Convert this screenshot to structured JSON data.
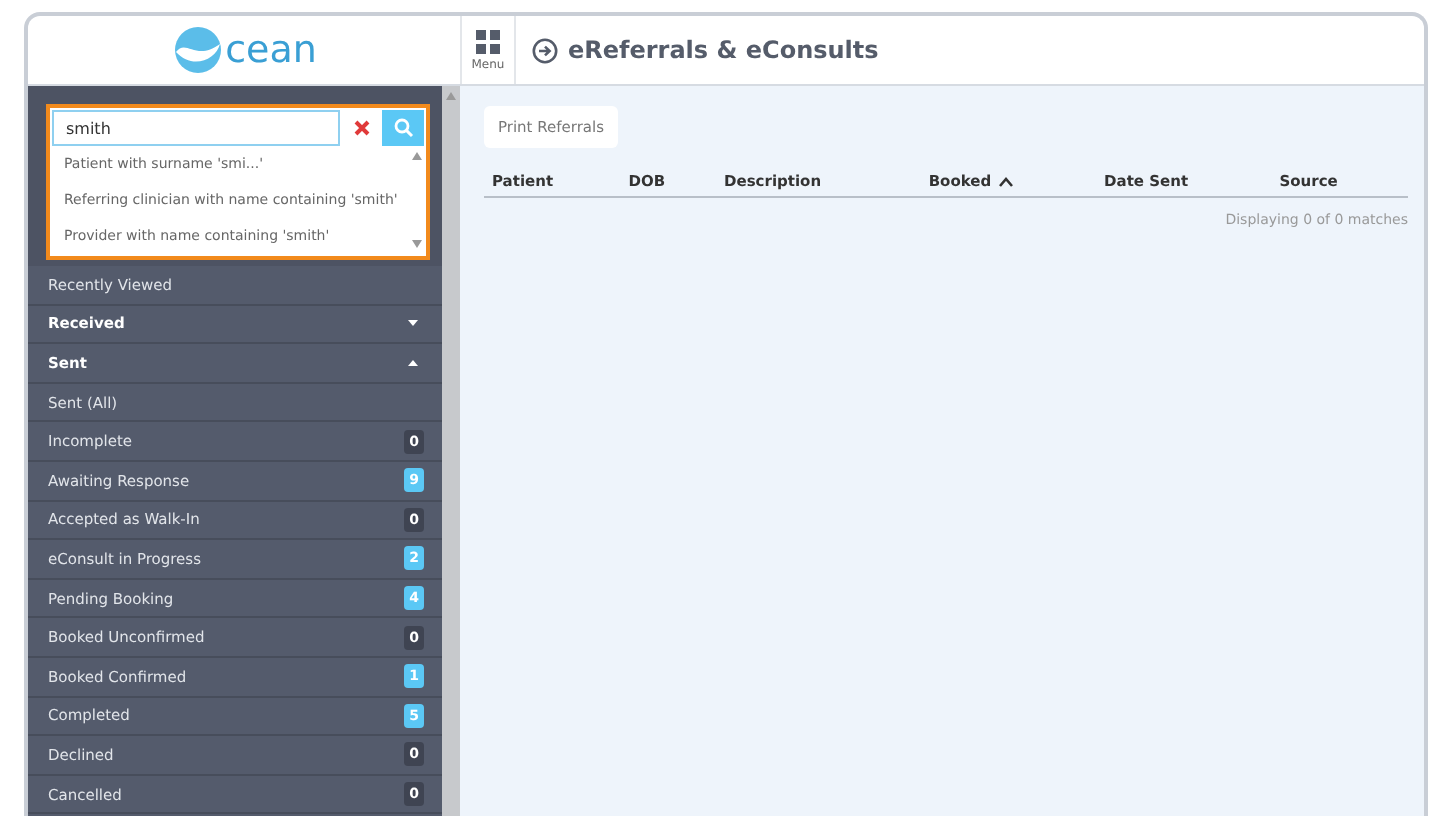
{
  "header": {
    "logo_text": "cean",
    "menu_label": "Menu",
    "title": "eReferrals & eConsults"
  },
  "search": {
    "value": "smith",
    "suggestions": [
      {
        "label": "Patient with surname 'smi...'"
      },
      {
        "label": "Referring clinician with name containing 'smith'"
      },
      {
        "label": "Provider with name containing 'smith'"
      }
    ]
  },
  "sidebar": {
    "items": [
      {
        "kind": "link",
        "label": "Recently Viewed"
      },
      {
        "kind": "section",
        "label": "Received",
        "expanded": false
      },
      {
        "kind": "section",
        "label": "Sent",
        "expanded": true
      },
      {
        "kind": "link",
        "label": "Sent (All)"
      },
      {
        "kind": "link",
        "label": "Incomplete",
        "count": "0",
        "color": "#3f4452"
      },
      {
        "kind": "link",
        "label": "Awaiting Response",
        "count": "9",
        "color": "#5bc8f5"
      },
      {
        "kind": "link",
        "label": "Accepted as Walk-In",
        "count": "0",
        "color": "#3f4452"
      },
      {
        "kind": "link",
        "label": "eConsult in Progress",
        "count": "2",
        "color": "#5bc8f5"
      },
      {
        "kind": "link",
        "label": "Pending Booking",
        "count": "4",
        "color": "#5bc8f5"
      },
      {
        "kind": "link",
        "label": "Booked Unconfirmed",
        "count": "0",
        "color": "#3f4452"
      },
      {
        "kind": "link",
        "label": "Booked Confirmed",
        "count": "1",
        "color": "#5bc8f5"
      },
      {
        "kind": "link",
        "label": "Completed",
        "count": "5",
        "color": "#5bc8f5"
      },
      {
        "kind": "link",
        "label": "Declined",
        "count": "0",
        "color": "#3f4452"
      },
      {
        "kind": "link",
        "label": "Cancelled",
        "count": "0",
        "color": "#3f4452"
      }
    ]
  },
  "toolbar": {
    "print_button": "Print Referrals"
  },
  "table": {
    "columns": [
      {
        "label": "Patient",
        "sorted": false
      },
      {
        "label": "DOB",
        "sorted": false
      },
      {
        "label": "Description",
        "sorted": false
      },
      {
        "label": "Booked",
        "sorted": true
      },
      {
        "label": "Date Sent",
        "sorted": false
      },
      {
        "label": "Source",
        "sorted": false
      }
    ],
    "footer": "Displaying 0 of 0 matches"
  }
}
